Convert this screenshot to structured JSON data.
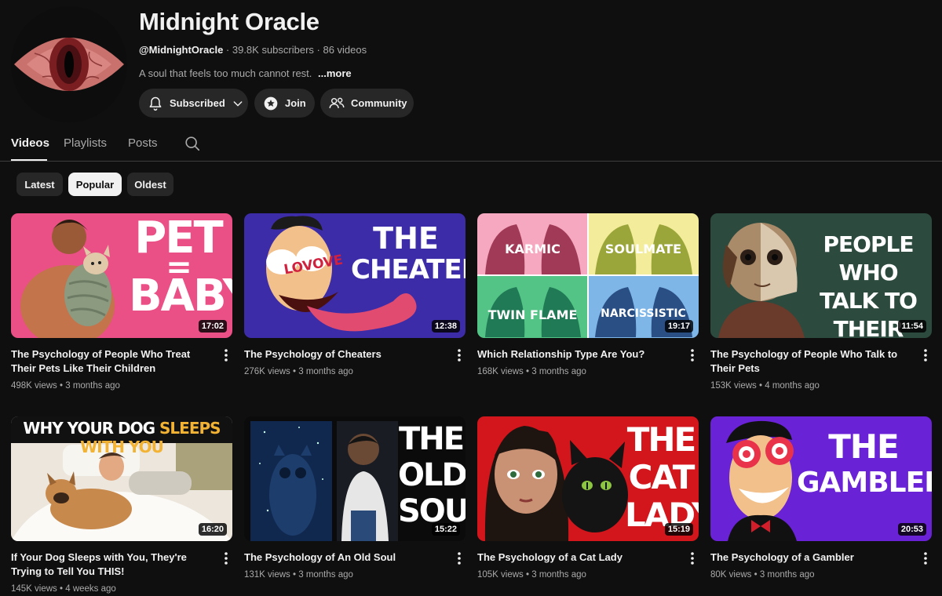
{
  "channel": {
    "name": "Midnight Oracle",
    "handle": "@MidnightOracle",
    "stats": "· 39.8K subscribers · 86 videos",
    "description": "A soul that feels too much cannot rest.",
    "more_label": "...more",
    "avatar_icon": "red-eye-avatar"
  },
  "buttons": {
    "subscribed": "Subscribed",
    "join": "Join",
    "community": "Community"
  },
  "tabs": [
    {
      "label": "Videos",
      "active": true
    },
    {
      "label": "Playlists",
      "active": false
    },
    {
      "label": "Posts",
      "active": false
    }
  ],
  "chips": [
    {
      "label": "Latest",
      "active": false
    },
    {
      "label": "Popular",
      "active": true
    },
    {
      "label": "Oldest",
      "active": false
    }
  ],
  "videos": [
    {
      "title": "The Psychology of People Who Treat Their Pets Like Their Children",
      "meta": "498K views • 3 months ago",
      "duration": "17:02",
      "thumb_text": [
        "PET",
        "=",
        "BABY"
      ]
    },
    {
      "title": "The Psychology of Cheaters",
      "meta": "276K views • 3 months ago",
      "duration": "12:38",
      "thumb_text": [
        "THE",
        "CHEATER",
        "LOVOVE"
      ]
    },
    {
      "title": "Which Relationship Type Are You?",
      "meta": "168K views • 3 months ago",
      "duration": "19:17",
      "thumb_text": [
        "KARMIC",
        "SOULMATE",
        "TWIN FLAME",
        "NARCISSISTIC"
      ]
    },
    {
      "title": "The Psychology of People Who Talk to Their Pets",
      "meta": "153K views • 4 months ago",
      "duration": "11:54",
      "thumb_text": [
        "PEOPLE WHO",
        "TALK TO",
        "THEIR PETS"
      ]
    },
    {
      "title": "If Your Dog Sleeps with You, They're Trying to Tell You THIS!",
      "meta": "145K views • 4 weeks ago",
      "duration": "16:20",
      "thumb_text": [
        "WHY YOUR DOG",
        "SLEEPS WITH YOU"
      ]
    },
    {
      "title": "The Psychology of An Old Soul",
      "meta": "131K views • 3 months ago",
      "duration": "15:22",
      "thumb_text": [
        "THE",
        "OLD",
        "SOUL"
      ]
    },
    {
      "title": "The Psychology of a Cat Lady",
      "meta": "105K views • 3 months ago",
      "duration": "15:19",
      "thumb_text": [
        "THE",
        "CAT",
        "LADY"
      ]
    },
    {
      "title": "The Psychology of a Gambler",
      "meta": "80K views • 3 months ago",
      "duration": "20:53",
      "thumb_text": [
        "THE",
        "GAMBLER"
      ]
    }
  ],
  "colors": {
    "background": "#0f0f0f",
    "button_bg": "#272727",
    "text_primary": "#f1f1f1",
    "text_secondary": "#aaaaaa"
  }
}
